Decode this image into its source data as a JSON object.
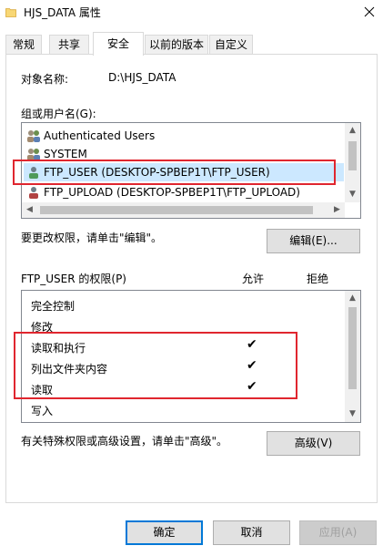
{
  "window": {
    "title": "HJS_DATA 属性",
    "close_glyph": "✕"
  },
  "tabs": [
    {
      "label": "常规",
      "active": false
    },
    {
      "label": "共享",
      "active": false
    },
    {
      "label": "安全",
      "active": true
    },
    {
      "label": "以前的版本",
      "active": false
    },
    {
      "label": "自定义",
      "active": false
    }
  ],
  "security": {
    "object_name_label": "对象名称:",
    "object_name_value": "D:\\HJS_DATA",
    "groups_label": "组或用户名(G):",
    "users": [
      {
        "name": "Authenticated Users",
        "icon": "group-users-icon",
        "selected": false
      },
      {
        "name": "SYSTEM",
        "icon": "group-users-icon",
        "selected": false
      },
      {
        "name": "FTP_USER (DESKTOP-SPBEP1T\\FTP_USER)",
        "icon": "user-icon",
        "selected": true
      },
      {
        "name": "FTP_UPLOAD (DESKTOP-SPBEP1T\\FTP_UPLOAD)",
        "icon": "user-icon",
        "selected": false
      }
    ],
    "edit_hint": "要更改权限，请单击\"编辑\"。",
    "edit_button": "编辑(E)...",
    "perm_header": "FTP_USER 的权限(P)",
    "allow_header": "允许",
    "deny_header": "拒绝",
    "permissions": [
      {
        "name": "完全控制",
        "allow": false,
        "deny": false
      },
      {
        "name": "修改",
        "allow": false,
        "deny": false
      },
      {
        "name": "读取和执行",
        "allow": true,
        "deny": false
      },
      {
        "name": "列出文件夹内容",
        "allow": true,
        "deny": false
      },
      {
        "name": "读取",
        "allow": true,
        "deny": false
      },
      {
        "name": "写入",
        "allow": false,
        "deny": false
      }
    ],
    "check_glyph": "✔",
    "advanced_hint": "有关特殊权限或高级设置，请单击\"高级\"。",
    "advanced_button": "高级(V)"
  },
  "footer": {
    "ok": "确定",
    "cancel": "取消",
    "apply": "应用(A)"
  },
  "colors": {
    "highlight": "#e0262f",
    "selection": "#cce8ff",
    "default_button_border": "#0078d7"
  }
}
